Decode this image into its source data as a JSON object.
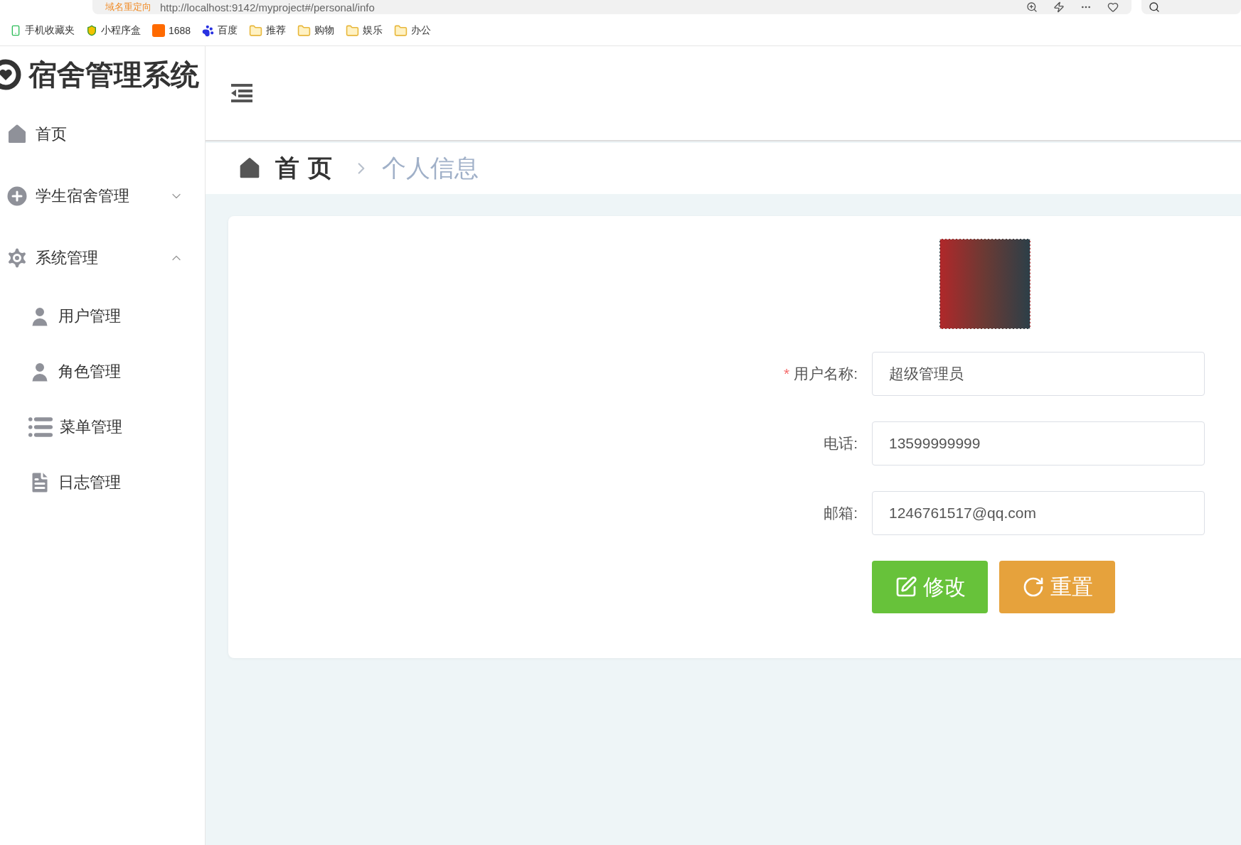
{
  "browser": {
    "redirect_label": "域名重定向",
    "url": "http://localhost:9142/myproject#/personal/info",
    "bookmarks": [
      {
        "label": "手机收藏夹",
        "kind": "phone"
      },
      {
        "label": "小程序盒",
        "kind": "shield"
      },
      {
        "label": "1688",
        "kind": "brand"
      },
      {
        "label": "百度",
        "kind": "paw"
      },
      {
        "label": "推荐",
        "kind": "folder"
      },
      {
        "label": "购物",
        "kind": "folder"
      },
      {
        "label": "娱乐",
        "kind": "folder"
      },
      {
        "label": "办公",
        "kind": "folder"
      }
    ]
  },
  "sidebar": {
    "title": "宿舍管理系统",
    "items": [
      {
        "label": "首页",
        "kind": "home"
      },
      {
        "label": "学生宿舍管理",
        "kind": "plus",
        "expanded": false
      },
      {
        "label": "系统管理",
        "kind": "gear",
        "expanded": true,
        "children": [
          {
            "label": "用户管理",
            "kind": "user"
          },
          {
            "label": "角色管理",
            "kind": "role"
          },
          {
            "label": "菜单管理",
            "kind": "list"
          },
          {
            "label": "日志管理",
            "kind": "log"
          }
        ]
      }
    ]
  },
  "breadcrumb": {
    "home": "首页",
    "current": "个人信息"
  },
  "form": {
    "fields": [
      {
        "label": "用户名称:",
        "value": "超级管理员",
        "required_mark": "*"
      },
      {
        "label": "电话:",
        "value": "13599999999"
      },
      {
        "label": "邮箱:",
        "value": "1246761517@qq.com"
      }
    ],
    "buttons": [
      {
        "label": "修改",
        "kind": "edit"
      },
      {
        "label": "重置",
        "kind": "reset"
      }
    ]
  }
}
